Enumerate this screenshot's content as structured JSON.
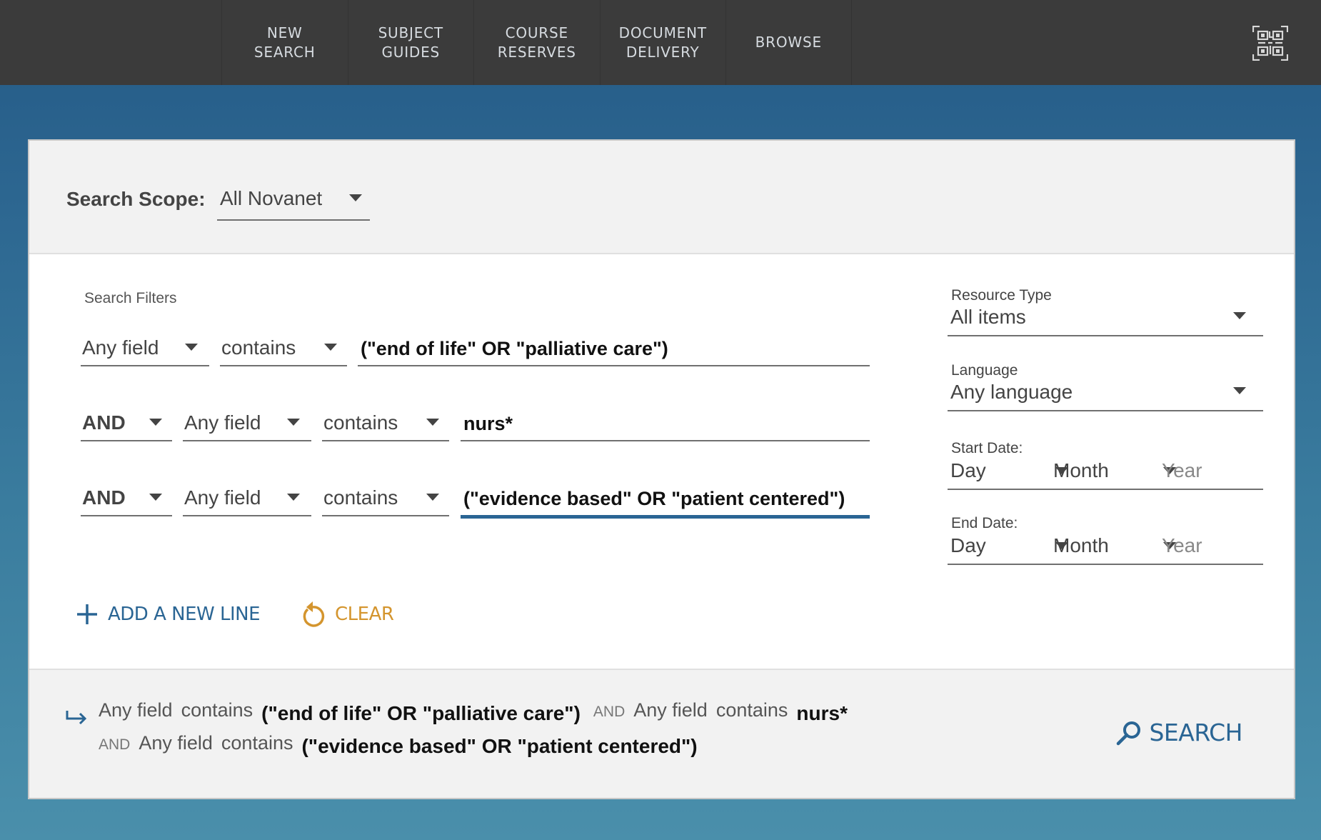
{
  "nav": {
    "items": [
      {
        "label": "NEW\nSEARCH"
      },
      {
        "label": "SUBJECT\nGUIDES"
      },
      {
        "label": "COURSE\nRESERVES"
      },
      {
        "label": "DOCUMENT\nDELIVERY"
      },
      {
        "label": "BROWSE"
      }
    ],
    "qr_icon": "qr-code-icon"
  },
  "scope": {
    "label": "Search Scope:",
    "value": "All Novanet"
  },
  "filters": {
    "label": "Search Filters",
    "rows": [
      {
        "operator": null,
        "field": "Any field",
        "condition": "contains",
        "term": "(\"end of life\" OR \"palliative care\")"
      },
      {
        "operator": "AND",
        "field": "Any field",
        "condition": "contains",
        "term": "nurs*"
      },
      {
        "operator": "AND",
        "field": "Any field",
        "condition": "contains",
        "term": "(\"evidence based\" OR \"patient centered\")",
        "focused": true
      }
    ]
  },
  "right": {
    "resource_type": {
      "label": "Resource Type",
      "value": "All items"
    },
    "language": {
      "label": "Language",
      "value": "Any language"
    },
    "start_date": {
      "label": "Start Date:",
      "day": "Day",
      "month": "Month",
      "year_placeholder": "Year"
    },
    "end_date": {
      "label": "End Date:",
      "day": "Day",
      "month": "Month",
      "year_placeholder": "Year"
    }
  },
  "actions": {
    "add_line": "ADD A NEW LINE",
    "clear": "CLEAR"
  },
  "summary": {
    "line1": [
      {
        "type": "fld",
        "text": "Any field"
      },
      {
        "type": "fld",
        "text": "contains"
      },
      {
        "type": "term",
        "text": "(\"end of life\" OR \"palliative care\")"
      },
      {
        "type": "op",
        "text": "AND"
      },
      {
        "type": "fld",
        "text": "Any field"
      },
      {
        "type": "fld",
        "text": "contains"
      },
      {
        "type": "term",
        "text": "nurs*"
      }
    ],
    "line2": [
      {
        "type": "op",
        "text": "AND"
      },
      {
        "type": "fld",
        "text": "Any field"
      },
      {
        "type": "fld",
        "text": "contains"
      },
      {
        "type": "term",
        "text": "(\"evidence based\" OR \"patient centered\")"
      }
    ]
  },
  "search_button": "SEARCH",
  "colors": {
    "nav_bg": "#3b3b3b",
    "accent_blue": "#2a6594",
    "clear_orange": "#d4952e"
  }
}
